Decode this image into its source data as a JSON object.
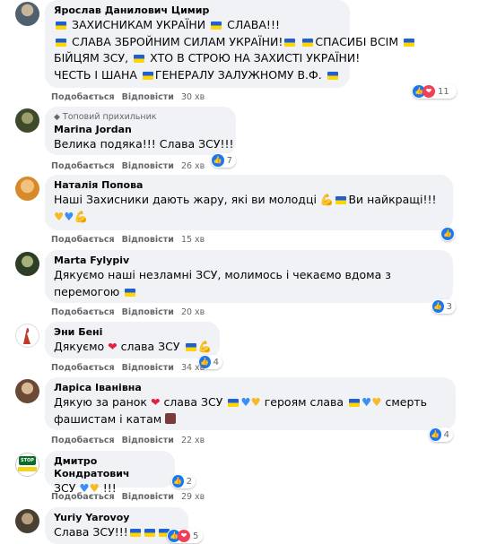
{
  "actions": {
    "like": "Подобається",
    "reply": "Відповісти"
  },
  "comments": [
    {
      "author": "Ярослав Данилович Цимир",
      "badge": "",
      "lines": [
        "ЗАХИСНИКАМ УКРАЇНИ",
        "СЛАВА!!!",
        "СЛАВА ЗБРОЙНИМ СИЛАМ УКРАЇНИ!",
        "СПАСИБІ ВСІМ",
        "БІЙЦЯМ ЗСУ,",
        "ХТО В СТРОЮ НА ЗАХИСТІ УКРАЇНИ!",
        "ЧЕСТЬ І ШАНА",
        "ГЕНЕРАЛУ ЗАЛУЖНОМУ В.Ф."
      ],
      "time": "30 хв",
      "reactions": "11"
    },
    {
      "author": "Marina Jordan",
      "badge": "Топовий прихильник",
      "lines": [
        "Велика подяка!!! Слава ЗСУ!!!"
      ],
      "time": "26 хв",
      "reactions": "7"
    },
    {
      "author": "Наталія Попова",
      "badge": "",
      "lines": [
        "Наші Захисники дають жару, які ви молодці",
        "Ви найкращі!!!"
      ],
      "time": "15 хв",
      "reactions": ""
    },
    {
      "author": "Marta Fylypiv",
      "badge": "",
      "lines": [
        "Дякуємо наші незламні ЗСУ, молимось і чекаємо вдома з",
        "перемогою"
      ],
      "time": "20 хв",
      "reactions": "3"
    },
    {
      "author": "Эни Бені",
      "badge": "",
      "lines": [
        "Дякуємо",
        "слава ЗСУ"
      ],
      "time": "34 хв",
      "reactions": "4"
    },
    {
      "author": "Ларіса Іванівна",
      "badge": "",
      "lines": [
        "Дякую за ранок",
        "слава ЗСУ",
        "героям слава",
        "смерть",
        "фашистам і катам"
      ],
      "time": "22 хв",
      "reactions": "4"
    },
    {
      "author": "Дмитро Кондратович",
      "badge": "",
      "lines": [
        "ЗСУ",
        "!!!"
      ],
      "time": "29 хв",
      "reactions": "2"
    },
    {
      "author": "Yuriy Yarovoy",
      "badge": "",
      "lines": [
        "Слава ЗСУ!!!"
      ],
      "time": "",
      "reactions": "5"
    }
  ],
  "avatar_text": {
    "stop": "STOP"
  },
  "colors": {
    "bubble": "#f0f2f5",
    "meta": "#65676b",
    "like": "#1877f2",
    "love": "#f33e58"
  }
}
